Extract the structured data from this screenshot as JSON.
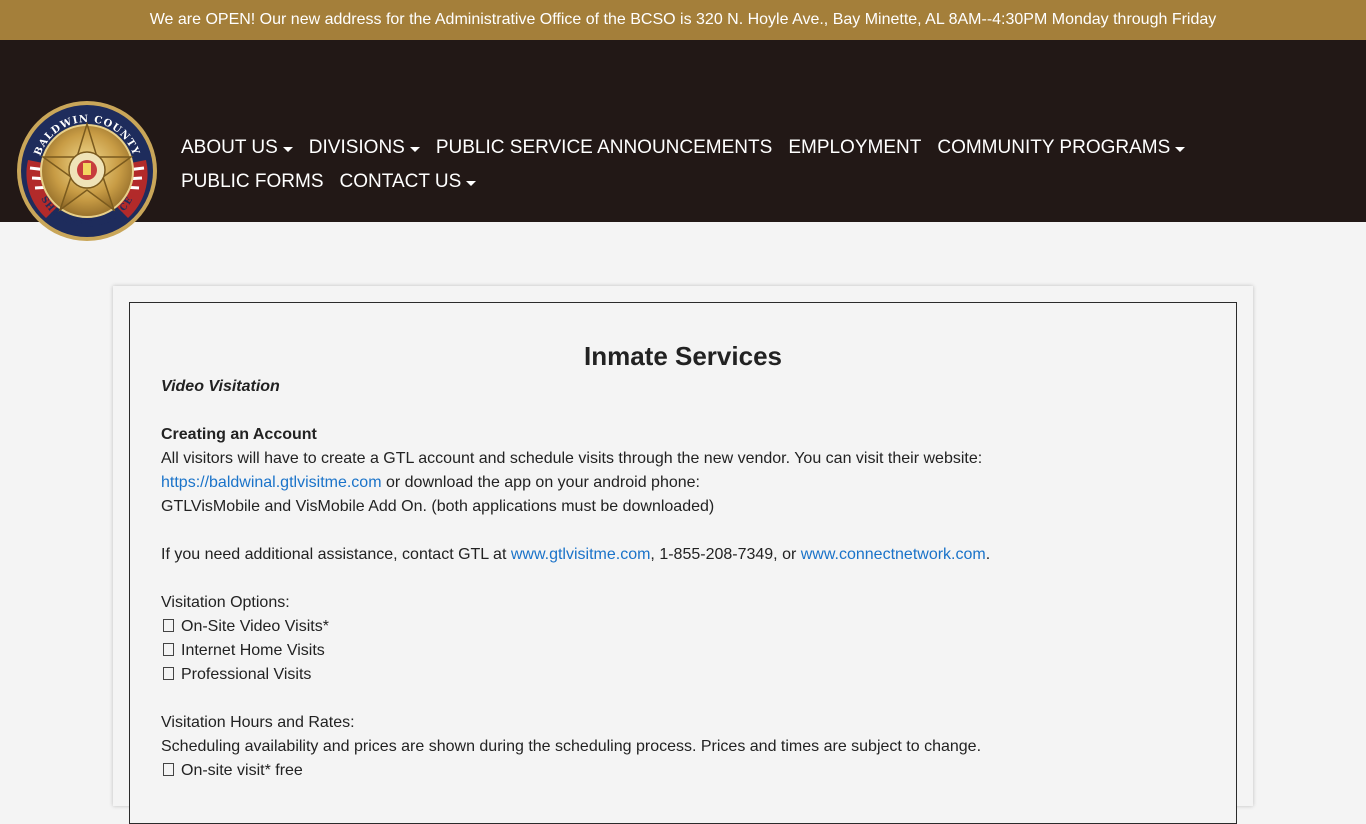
{
  "banner": {
    "text": "We are OPEN! Our new address for the Administrative Office of the BCSO is 320 N. Hoyle Ave., Bay Minette, AL 8AM--4:30PM Monday through Friday"
  },
  "logo": {
    "top_text": "BALDWIN COUNTY",
    "bottom_text": "SHERIFF'S OFFICE"
  },
  "nav": {
    "about": "ABOUT US",
    "divisions": "DIVISIONS",
    "psa": "PUBLIC SERVICE ANNOUNCEMENTS",
    "employment": "EMPLOYMENT",
    "community": "COMMUNITY PROGRAMS",
    "forms": "PUBLIC FORMS",
    "contact": "CONTACT US"
  },
  "page": {
    "title": "Inmate Services",
    "section_heading": "Video Visitation",
    "account_heading": "Creating an Account",
    "account_text": "All visitors will have to create a GTL account and schedule visits through the new vendor. You can visit their website:",
    "website_link": "https://baldwinal.gtlvisitme.com",
    "download_text": " or download the app on your android phone:",
    "apps_text": "GTLVisMobile and VisMobile Add On. (both applications must be downloaded)",
    "assist_prefix": "If you need additional assistance, contact GTL at ",
    "gtl_link": "www.gtlvisitme.com",
    "assist_middle": ", 1-855-208-7349, or ",
    "connect_link": "www.connectnetwork.com",
    "assist_suffix": ".",
    "options_heading": "Visitation Options:",
    "options": [
      "On-Site Video Visits*",
      "Internet Home Visits",
      "Professional Visits"
    ],
    "hours_heading": "Visitation Hours and Rates:",
    "hours_text": "Scheduling availability and prices are shown during the scheduling process. Prices and times are subject to change.",
    "partial_item": "On-site visit* free"
  }
}
